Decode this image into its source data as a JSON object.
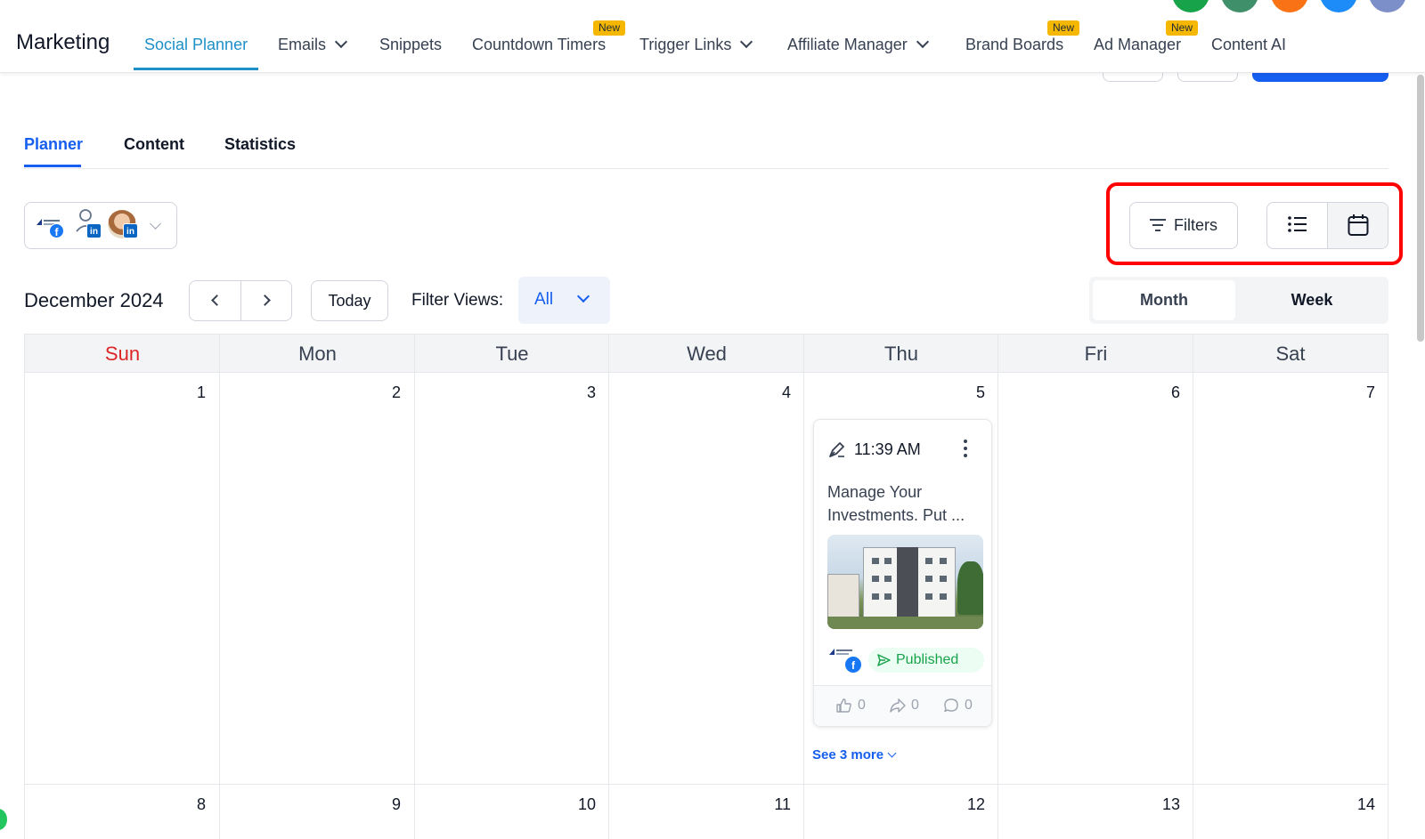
{
  "header": {
    "brand": "Marketing",
    "nav": [
      {
        "label": "Social Planner",
        "active": true,
        "dropdown": false,
        "badge": ""
      },
      {
        "label": "Emails",
        "active": false,
        "dropdown": true,
        "badge": ""
      },
      {
        "label": "Snippets",
        "active": false,
        "dropdown": false,
        "badge": ""
      },
      {
        "label": "Countdown Timers",
        "active": false,
        "dropdown": false,
        "badge": "New"
      },
      {
        "label": "Trigger Links",
        "active": false,
        "dropdown": true,
        "badge": ""
      },
      {
        "label": "Affiliate Manager",
        "active": false,
        "dropdown": true,
        "badge": ""
      },
      {
        "label": "Brand Boards",
        "active": false,
        "dropdown": false,
        "badge": "New"
      },
      {
        "label": "Ad Manager",
        "active": false,
        "dropdown": false,
        "badge": "New"
      },
      {
        "label": "Content AI",
        "active": false,
        "dropdown": false,
        "badge": ""
      }
    ],
    "top_icon_colors": [
      "#16a34a",
      "#3f8f6a",
      "#f97316",
      "#1d8cf8",
      "#7c8fc8"
    ]
  },
  "tabs": [
    {
      "label": "Planner",
      "active": true
    },
    {
      "label": "Content",
      "active": false
    },
    {
      "label": "Statistics",
      "active": false
    }
  ],
  "toolbar": {
    "filters_label": "Filters",
    "list_view_icon": "list-icon",
    "calendar_view_icon": "calendar-icon",
    "highlight_color": "#ff0000"
  },
  "calendar": {
    "month_title": "December 2024",
    "today_label": "Today",
    "filter_views_label": "Filter Views:",
    "filter_views_value": "All",
    "view_month": "Month",
    "view_week": "Week",
    "weekdays": [
      "Sun",
      "Mon",
      "Tue",
      "Wed",
      "Thu",
      "Fri",
      "Sat"
    ],
    "weeks": [
      [
        "1",
        "2",
        "3",
        "4",
        "5",
        "6",
        "7"
      ],
      [
        "8",
        "9",
        "10",
        "11",
        "12",
        "13",
        "14"
      ]
    ],
    "see_more": "See 3 more"
  },
  "post": {
    "time": "11:39 AM",
    "text_line1": "Manage Your",
    "text_line2": "Investments. Put ...",
    "status": "Published",
    "likes": "0",
    "shares": "0",
    "comments": "0"
  },
  "colors": {
    "accent": "#155eef",
    "nav_active": "#1e90c8",
    "sunday": "#dc2626",
    "published": "#16a34a",
    "badge": "#f5b700"
  }
}
